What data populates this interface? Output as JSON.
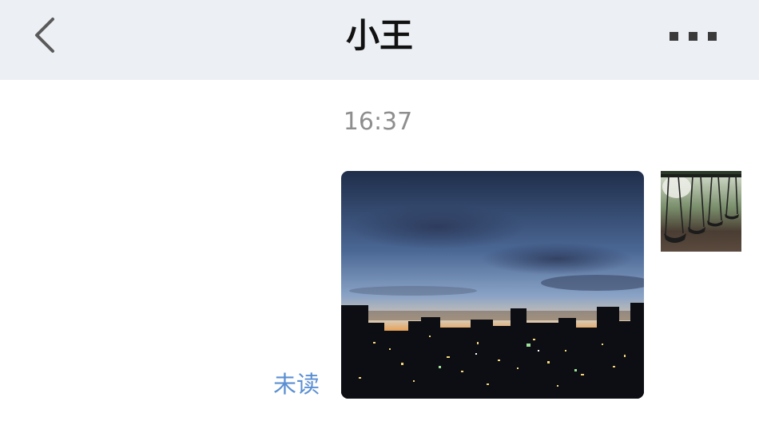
{
  "nav": {
    "title": "小王",
    "back_icon": "chevron-left-icon",
    "more_icon": "more-dots-icon",
    "background": "#eceff4"
  },
  "chat": {
    "timestamp": "16:37",
    "messages": [
      {
        "type": "image",
        "content": "city-skyline-at-dusk-photo",
        "status": "未读",
        "avatar": "swing-set-avatar"
      }
    ]
  },
  "colors": {
    "unread_text": "#5b8fd2",
    "timestamp_text": "#8e8e8e"
  }
}
